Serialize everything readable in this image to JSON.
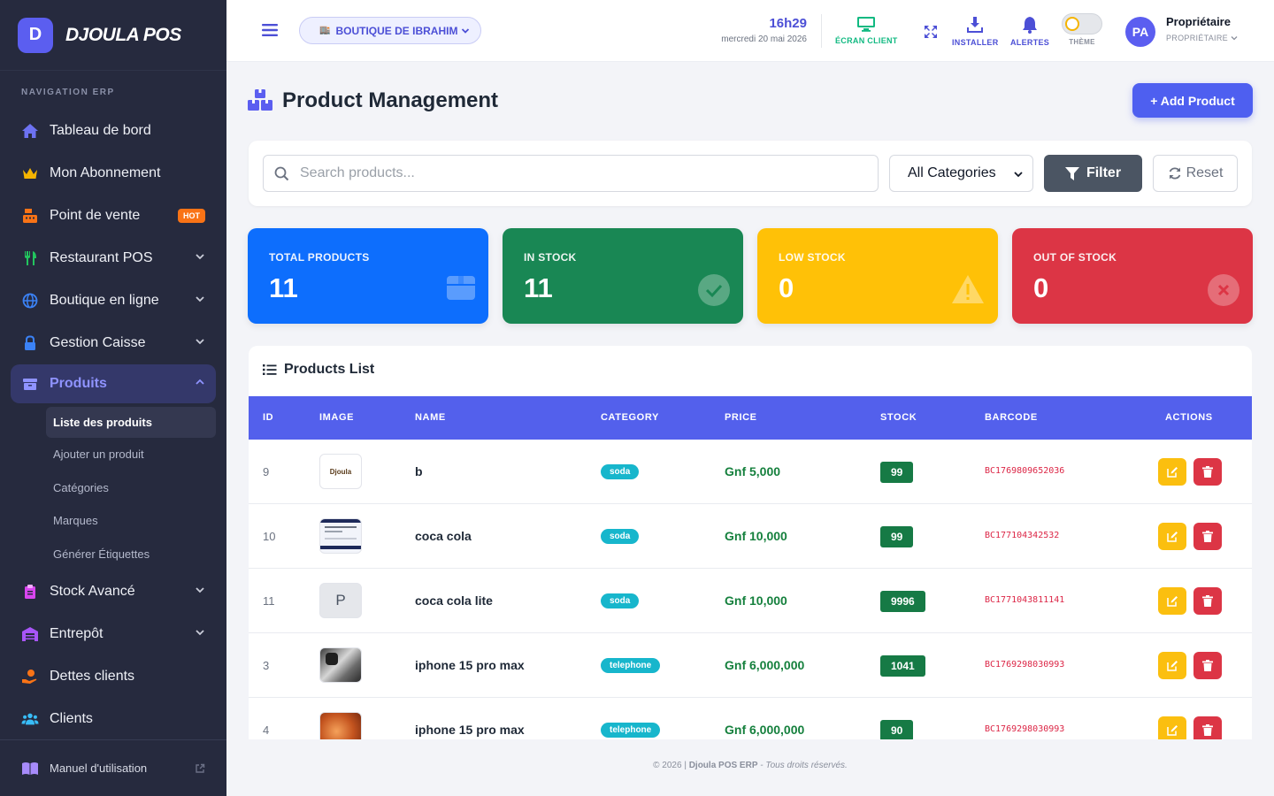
{
  "brand": {
    "logo_letter": "D",
    "name": "DJOULA POS"
  },
  "sidebar": {
    "section_label": "NAVIGATION ERP",
    "items": [
      {
        "label": "Tableau de bord",
        "icon": "home-icon"
      },
      {
        "label": "Mon Abonnement",
        "icon": "crown-icon"
      },
      {
        "label": "Point de vente",
        "icon": "cash-register-icon",
        "badge": "HOT"
      },
      {
        "label": "Restaurant POS",
        "icon": "utensils-icon"
      },
      {
        "label": "Boutique en ligne",
        "icon": "globe-icon"
      },
      {
        "label": "Gestion Caisse",
        "icon": "lock-icon"
      },
      {
        "label": "Produits",
        "icon": "box-icon"
      },
      {
        "label": "Stock Avancé",
        "icon": "clipboard-icon"
      },
      {
        "label": "Entrepôt",
        "icon": "warehouse-icon"
      },
      {
        "label": "Dettes clients",
        "icon": "hand-money-icon"
      },
      {
        "label": "Clients",
        "icon": "users-icon"
      }
    ],
    "sub_items": [
      "Liste des produits",
      "Ajouter un produit",
      "Catégories",
      "Marques",
      "Générer Étiquettes"
    ],
    "footer_label": "Manuel d'utilisation"
  },
  "topbar": {
    "store_name": "BOUTIQUE DE IBRAHIM",
    "time": "16h29",
    "date": "mercredi 20 mai 2026",
    "client_screen_label": "ÉCRAN CLIENT",
    "install_label": "INSTALLER",
    "alerts_label": "ALERTES",
    "theme_label": "THÈME",
    "avatar_initials": "PA",
    "user_name": "Propriétaire",
    "user_role": "PROPRIÉTAIRE"
  },
  "page": {
    "title": "Product Management",
    "add_button": "+ Add Product",
    "search_placeholder": "Search products...",
    "category_select": "All Categories",
    "filter_button": "Filter",
    "reset_button": "Reset"
  },
  "stats": [
    {
      "label": "TOTAL PRODUCTS",
      "value": "11",
      "color": "#0d6efd",
      "icon": "box-icon"
    },
    {
      "label": "IN STOCK",
      "value": "11",
      "color": "#198754",
      "icon": "check-circle-icon"
    },
    {
      "label": "LOW STOCK",
      "value": "0",
      "color": "#ffc107",
      "icon": "warning-icon"
    },
    {
      "label": "OUT OF STOCK",
      "value": "0",
      "color": "#dc3545",
      "icon": "x-circle-icon"
    }
  ],
  "table": {
    "title": "Products List",
    "columns": [
      "ID",
      "IMAGE",
      "NAME",
      "CATEGORY",
      "PRICE",
      "STOCK",
      "BARCODE",
      "ACTIONS"
    ],
    "rows": [
      {
        "id": "9",
        "image": "djoula-logo",
        "image_text": "Djoula",
        "name": "b",
        "category": "soda",
        "price": "Gnf 5,000",
        "stock": "99",
        "barcode": "BC1769809652036"
      },
      {
        "id": "10",
        "image": "screenshot",
        "image_text": "",
        "name": "coca cola",
        "category": "soda",
        "price": "Gnf 10,000",
        "stock": "99",
        "barcode": "BC177104342532"
      },
      {
        "id": "11",
        "image": "placeholder-letter",
        "image_text": "P",
        "name": "coca cola lite",
        "category": "soda",
        "price": "Gnf 10,000",
        "stock": "9996",
        "barcode": "BC1771043811141"
      },
      {
        "id": "3",
        "image": "phone-photo",
        "image_text": "",
        "name": "iphone 15 pro max",
        "category": "telephone",
        "price": "Gnf 6,000,000",
        "stock": "1041",
        "barcode": "BC1769298030993"
      },
      {
        "id": "4",
        "image": "food-photo",
        "image_text": "",
        "name": "iphone 15 pro max",
        "category": "telephone",
        "price": "Gnf 6,000,000",
        "stock": "90",
        "barcode": "BC1769298030993"
      }
    ]
  },
  "footer": {
    "copyright_year": "© 2026 | ",
    "app_name": "Djoula POS ERP",
    "rights": " - Tous droits réservés."
  }
}
